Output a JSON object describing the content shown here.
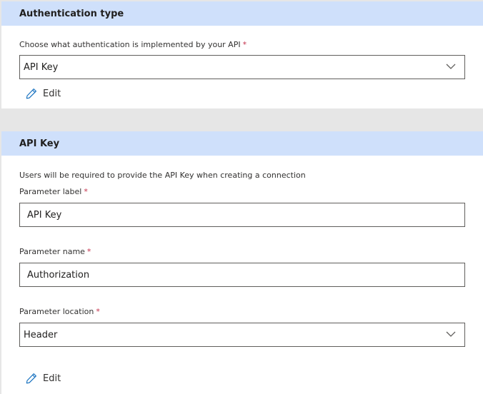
{
  "auth_section": {
    "title": "Authentication type",
    "field_label": "Choose what authentication is implemented by your API",
    "required_mark": "*",
    "selected_value": "API Key",
    "edit_label": "Edit"
  },
  "apikey_section": {
    "title": "API Key",
    "description": "Users will be required to provide the API Key when creating a connection",
    "parameter_label": {
      "label": "Parameter label",
      "required_mark": "*",
      "value": "API Key"
    },
    "parameter_name": {
      "label": "Parameter name",
      "required_mark": "*",
      "value": "Authorization"
    },
    "parameter_location": {
      "label": "Parameter location",
      "required_mark": "*",
      "selected_value": "Header"
    },
    "edit_label": "Edit"
  },
  "icons": [
    "edit-pencil-icon",
    "chevron-down-icon"
  ]
}
